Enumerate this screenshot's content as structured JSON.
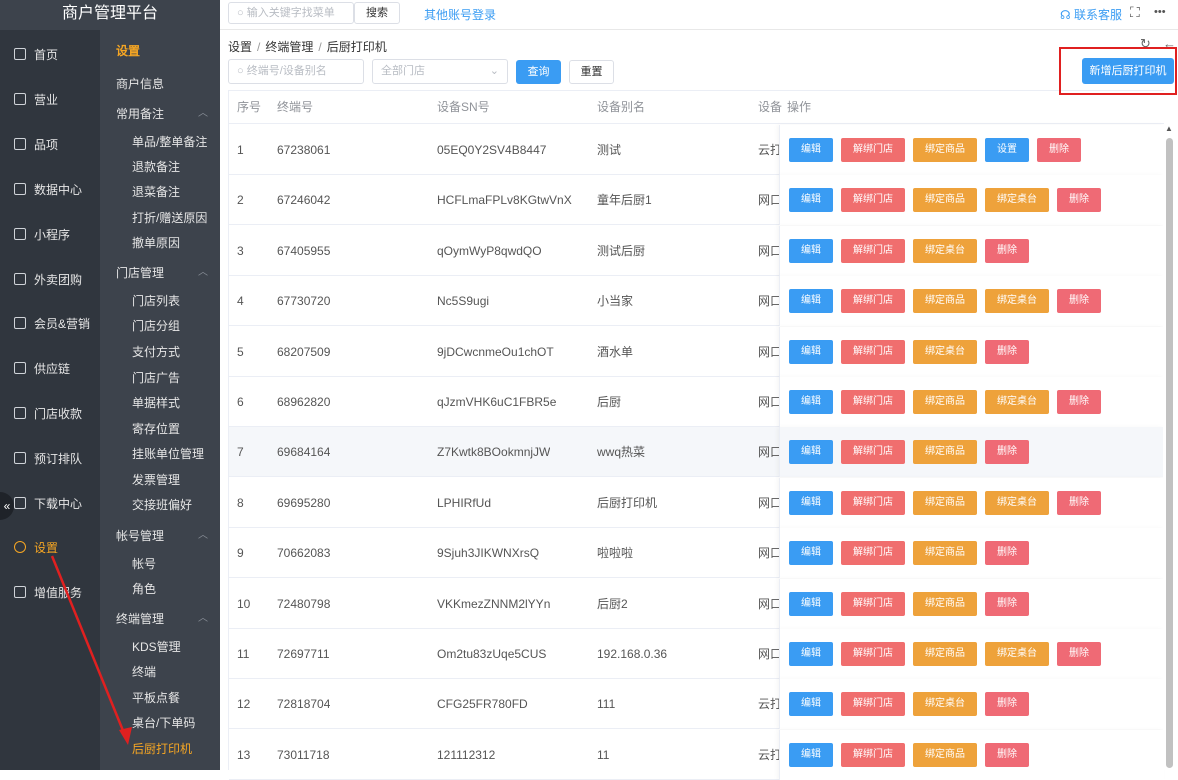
{
  "app": {
    "title": "商户管理平台"
  },
  "topbar": {
    "search_placeholder": "输入关键字找菜单",
    "search_btn": "搜索",
    "other_login": "其他账号登录",
    "support": "联系客服",
    "more": "•••"
  },
  "nav": [
    {
      "label": "首页",
      "icon": "home-icon"
    },
    {
      "label": "营业",
      "icon": "calendar-icon"
    },
    {
      "label": "品项",
      "icon": "bag-icon"
    },
    {
      "label": "数据中心",
      "icon": "share-icon"
    },
    {
      "label": "小程序",
      "icon": "phone-icon"
    },
    {
      "label": "外卖团购",
      "icon": "bike-icon"
    },
    {
      "label": "会员&营销",
      "icon": "user-icon"
    },
    {
      "label": "供应链",
      "icon": "truck-icon"
    },
    {
      "label": "门店收款",
      "icon": "coin-icon"
    },
    {
      "label": "预订排队",
      "icon": "clock-icon"
    },
    {
      "label": "下载中心",
      "icon": "download-icon"
    },
    {
      "label": "设置",
      "icon": "gear-icon"
    },
    {
      "label": "增值服务",
      "icon": "bell-icon"
    }
  ],
  "subnav": {
    "title": "设置",
    "items": [
      {
        "label": "商户信息",
        "level": 1
      },
      {
        "label": "常用备注",
        "level": 1,
        "group": true
      },
      {
        "label": "单品/整单备注",
        "level": 2
      },
      {
        "label": "退款备注",
        "level": 2
      },
      {
        "label": "退菜备注",
        "level": 2
      },
      {
        "label": "打折/赠送原因",
        "level": 2
      },
      {
        "label": "撤单原因",
        "level": 2
      },
      {
        "label": "门店管理",
        "level": 1,
        "group": true
      },
      {
        "label": "门店列表",
        "level": 2
      },
      {
        "label": "门店分组",
        "level": 2
      },
      {
        "label": "支付方式",
        "level": 2
      },
      {
        "label": "门店广告",
        "level": 2
      },
      {
        "label": "单据样式",
        "level": 2
      },
      {
        "label": "寄存位置",
        "level": 2
      },
      {
        "label": "挂账单位管理",
        "level": 2
      },
      {
        "label": "发票管理",
        "level": 2
      },
      {
        "label": "交接班偏好",
        "level": 2
      },
      {
        "label": "帐号管理",
        "level": 1,
        "group": true
      },
      {
        "label": "帐号",
        "level": 2
      },
      {
        "label": "角色",
        "level": 2
      },
      {
        "label": "终端管理",
        "level": 1,
        "group": true
      },
      {
        "label": "KDS管理",
        "level": 2
      },
      {
        "label": "终端",
        "level": 2
      },
      {
        "label": "平板点餐",
        "level": 2
      },
      {
        "label": "桌台/下单码",
        "level": 2
      },
      {
        "label": "后厨打印机",
        "level": 2,
        "active": true
      }
    ]
  },
  "breadcrumb": [
    "设置",
    "终端管理",
    "后厨打印机"
  ],
  "filters": {
    "terminal_placeholder": "终端号/设备别名",
    "store_select": "全部门店",
    "query": "查询",
    "reset": "重置",
    "add": "新增后厨打印机"
  },
  "table": {
    "headers": [
      "序号",
      "终端号",
      "设备SN号",
      "设备别名",
      "设备",
      "操作"
    ],
    "rows": [
      {
        "no": "1",
        "terminal": "67238061",
        "sn": "05EQ0Y2SV4B8447",
        "alias": "测试",
        "device": "云打",
        "ops": [
          "编辑",
          "解绑门店",
          "绑定商品",
          "设置",
          "删除"
        ]
      },
      {
        "no": "2",
        "terminal": "67246042",
        "sn": "HCFLmaFPLv8KGtwVnX",
        "alias": "童年后厨1",
        "device": "网口",
        "ops": [
          "编辑",
          "解绑门店",
          "绑定商品",
          "绑定桌台",
          "删除"
        ]
      },
      {
        "no": "3",
        "terminal": "67405955",
        "sn": "qOymWyP8qwdQO",
        "alias": "测试后厨",
        "device": "网口",
        "ops": [
          "编辑",
          "解绑门店",
          "绑定桌台",
          "删除"
        ]
      },
      {
        "no": "4",
        "terminal": "67730720",
        "sn": "Nc5S9ugi",
        "alias": "小当家",
        "device": "网口",
        "ops": [
          "编辑",
          "解绑门店",
          "绑定商品",
          "绑定桌台",
          "删除"
        ]
      },
      {
        "no": "5",
        "terminal": "68207509",
        "sn": "9jDCwcnmeOu1chOT",
        "alias": "酒水单",
        "device": "网口",
        "ops": [
          "编辑",
          "解绑门店",
          "绑定桌台",
          "删除"
        ]
      },
      {
        "no": "6",
        "terminal": "68962820",
        "sn": "qJzmVHK6uC1FBR5e",
        "alias": "后厨",
        "device": "网口",
        "ops": [
          "编辑",
          "解绑门店",
          "绑定商品",
          "绑定桌台",
          "删除"
        ]
      },
      {
        "no": "7",
        "terminal": "69684164",
        "sn": "Z7Kwtk8BOokmnjJW",
        "alias": "wwq热菜",
        "device": "网口",
        "ops": [
          "编辑",
          "解绑门店",
          "绑定商品",
          "删除"
        ]
      },
      {
        "no": "8",
        "terminal": "69695280",
        "sn": "LPHIRfUd",
        "alias": "后厨打印机",
        "device": "网口",
        "ops": [
          "编辑",
          "解绑门店",
          "绑定商品",
          "绑定桌台",
          "删除"
        ]
      },
      {
        "no": "9",
        "terminal": "70662083",
        "sn": "9Sjuh3JIKWNXrsQ",
        "alias": "啦啦啦",
        "device": "网口",
        "ops": [
          "编辑",
          "解绑门店",
          "绑定商品",
          "删除"
        ]
      },
      {
        "no": "10",
        "terminal": "72480798",
        "sn": "VKKmezZNNM2lYYn",
        "alias": "后厨2",
        "device": "网口",
        "ops": [
          "编辑",
          "解绑门店",
          "绑定商品",
          "删除"
        ]
      },
      {
        "no": "11",
        "terminal": "72697711",
        "sn": "Om2tu83zUqe5CUS",
        "alias": "192.168.0.36",
        "device": "网口",
        "ops": [
          "编辑",
          "解绑门店",
          "绑定商品",
          "绑定桌台",
          "删除"
        ]
      },
      {
        "no": "12",
        "terminal": "72818704",
        "sn": "CFG25FR780FD",
        "alias": "111",
        "device": "云打",
        "ops": [
          "编辑",
          "解绑门店",
          "绑定桌台",
          "删除"
        ]
      },
      {
        "no": "13",
        "terminal": "73011718",
        "sn": "121112312",
        "alias": "11",
        "device": "云打",
        "ops": [
          "编辑",
          "解绑门店",
          "绑定商品",
          "删除"
        ]
      }
    ]
  },
  "colors": {
    "accent": "#3a9cf3",
    "danger": "#f06e6e",
    "warning": "#eea23b",
    "sidebar": "#30363e",
    "active": "#f6a623",
    "annotation": "#e02020"
  }
}
